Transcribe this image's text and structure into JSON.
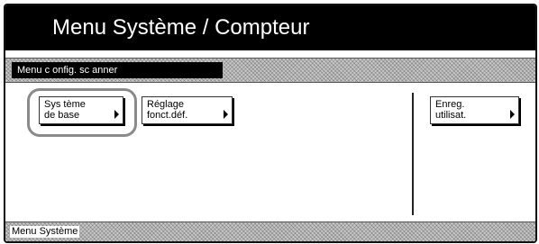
{
  "header": {
    "title": "Menu Système / Compteur"
  },
  "submenu": {
    "tab_label": "Menu c onfig. sc anner"
  },
  "buttons": {
    "systeme_base": {
      "line1": "Sys tème",
      "line2": "de base"
    },
    "reglage": {
      "line1": "Réglage",
      "line2": "fonct.déf."
    },
    "enreg": {
      "line1": "Enreg.",
      "line2": "utilisat."
    }
  },
  "status": {
    "text": "Menu Système"
  },
  "colors": {
    "title_bg": "#000000",
    "highlight_ring": "#8a8a8a",
    "pattern": "#c8c8c8"
  }
}
